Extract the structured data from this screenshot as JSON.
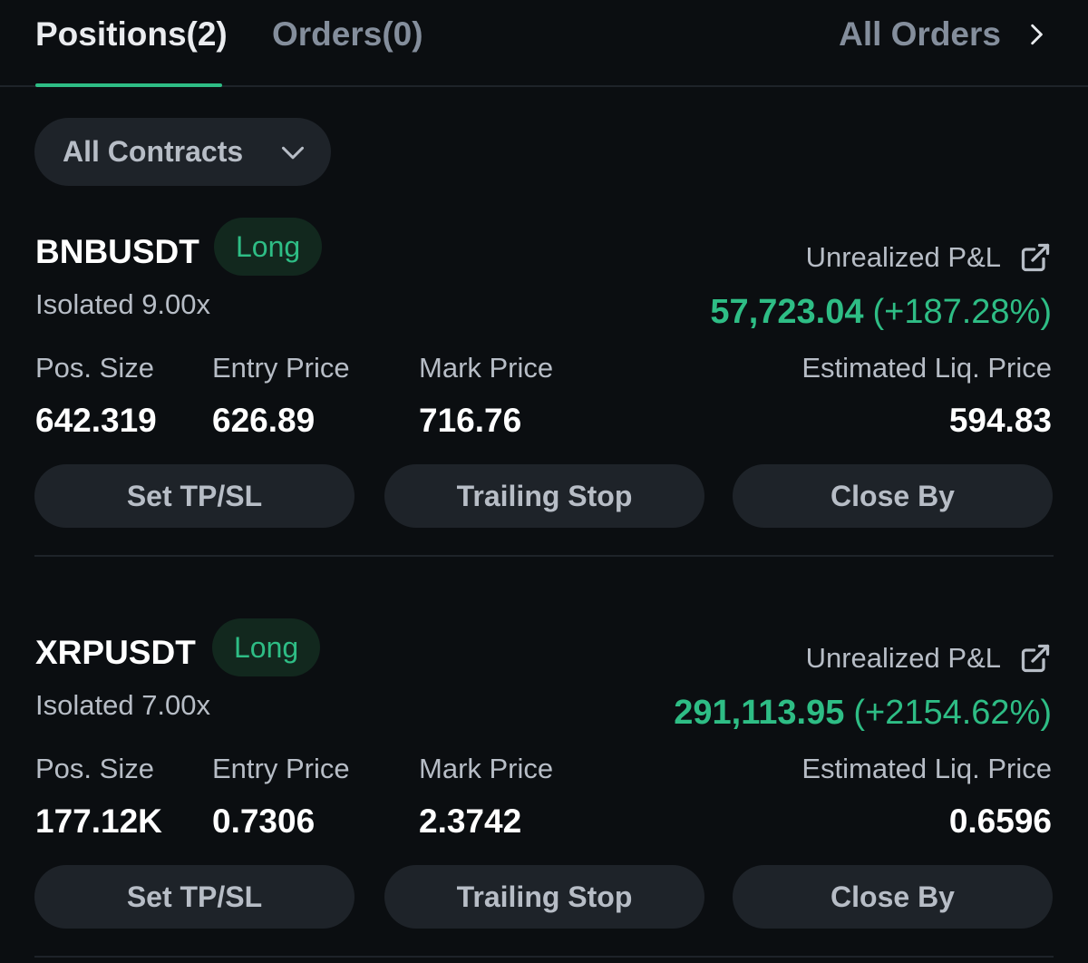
{
  "tabs": {
    "positions": "Positions(2)",
    "orders": "Orders(0)",
    "all_orders": "All Orders"
  },
  "filter": {
    "label": "All Contracts"
  },
  "labels": {
    "pnl": "Unrealized P&L",
    "pos_size": "Pos. Size",
    "entry_price": "Entry Price",
    "mark_price": "Mark Price",
    "liq_price": "Estimated Liq. Price"
  },
  "buttons": {
    "tpsl": "Set TP/SL",
    "trailing": "Trailing Stop",
    "close": "Close By"
  },
  "positions": [
    {
      "symbol": "BNBUSDT",
      "side": "Long",
      "margin": "Isolated 9.00x",
      "pnl_amount": "57,723.04",
      "pnl_percent": "(+187.28%)",
      "pos_size": "642.319",
      "entry_price": "626.89",
      "mark_price": "716.76",
      "liq_price": "594.83"
    },
    {
      "symbol": "XRPUSDT",
      "side": "Long",
      "margin": "Isolated 7.00x",
      "pnl_amount": "291,113.95",
      "pnl_percent": "(+2154.62%)",
      "pos_size": "177.12K",
      "entry_price": "0.7306",
      "mark_price": "2.3742",
      "liq_price": "0.6596"
    }
  ],
  "colors": {
    "background": "#0b0e11",
    "profit": "#2ebd85",
    "muted": "#848e9c",
    "button_bg": "#1e2329"
  },
  "icons": {
    "all_orders": "chevron-right-icon",
    "filter": "chevron-down-icon",
    "pnl_share": "external-link-icon"
  }
}
